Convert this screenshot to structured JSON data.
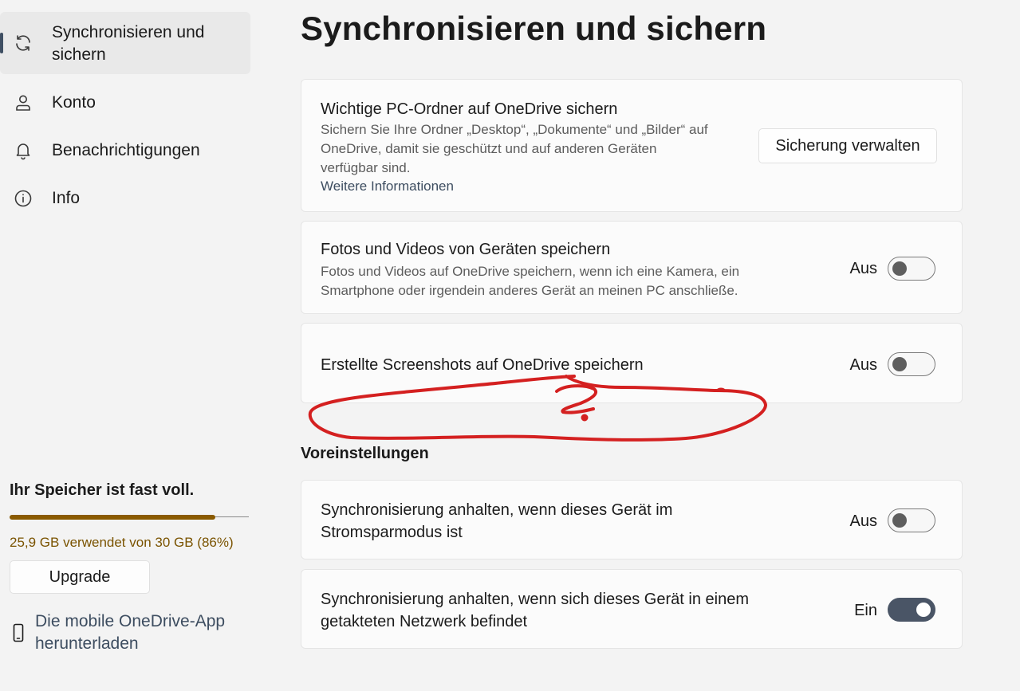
{
  "sidebar": {
    "items": [
      {
        "label": "Synchronisieren und sichern",
        "icon": "sync-icon",
        "active": true
      },
      {
        "label": "Konto",
        "icon": "person-icon",
        "active": false
      },
      {
        "label": "Benachrichtigungen",
        "icon": "bell-icon",
        "active": false
      },
      {
        "label": "Info",
        "icon": "info-icon",
        "active": false
      }
    ],
    "storage": {
      "title": "Ihr Speicher ist fast voll.",
      "used_percent": 86,
      "text": "25,9 GB verwendet von 30 GB (86%)",
      "upgrade_label": "Upgrade",
      "bar_color": "#8a5a00"
    },
    "mobile_link": {
      "line1": "Die mobile OneDrive-App",
      "line2": "herunterladen",
      "icon": "phone-icon"
    }
  },
  "main": {
    "title": "Synchronisieren und sichern",
    "backup_card": {
      "title": "Wichtige PC-Ordner auf OneDrive sichern",
      "desc_line1": "Sichern Sie Ihre Ordner „Desktop“, „Dokumente“ und „Bilder“ auf",
      "desc_line2": "OneDrive, damit sie geschützt und auf anderen Geräten",
      "desc_line3": "verfügbar sind.",
      "link": "Weitere Informationen",
      "button": "Sicherung verwalten"
    },
    "photos_card": {
      "title": "Fotos und Videos von Geräten speichern",
      "desc_line1": "Fotos und Videos auf OneDrive speichern, wenn ich eine Kamera, ein",
      "desc_line2": "Smartphone oder irgendein anderes Gerät an meinen PC anschließe.",
      "state": "Aus",
      "on": false
    },
    "screenshots_card": {
      "title": "Erstellte Screenshots auf OneDrive speichern",
      "state": "Aus",
      "on": false
    },
    "preferences_heading": "Voreinstellungen",
    "battery_card": {
      "line1": "Synchronisierung anhalten, wenn dieses Gerät im",
      "line2": "Stromsparmodus ist",
      "state": "Aus",
      "on": false
    },
    "metered_card": {
      "line1": "Synchronisierung anhalten, wenn sich dieses Gerät in einem",
      "line2": "getakteten Netzwerk befindet",
      "state": "Ein",
      "on": true
    },
    "annotation": {
      "text": "?",
      "color": "#d42020"
    }
  }
}
